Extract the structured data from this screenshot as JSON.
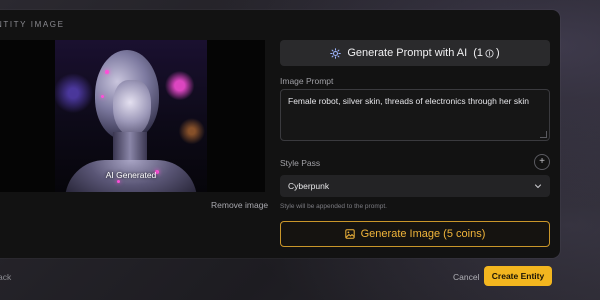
{
  "modal": {
    "section_title": "NTITY IMAGE"
  },
  "image": {
    "overlay_label": "AI Generated",
    "remove_label": "Remove image"
  },
  "form": {
    "generate_prompt_label": "Generate Prompt with AI",
    "generate_prompt_cost": "(1",
    "generate_prompt_cost_close": ")",
    "prompt_label": "Image Prompt",
    "prompt_value": "Female robot, silver skin, threads of electronics through her skin",
    "style_label": "Style Pass",
    "style_add_icon": "plus-icon",
    "style_value": "Cyberpunk",
    "style_hint": "Style will be appended to the prompt.",
    "generate_image_label": "Generate Image (5 coins)"
  },
  "footer": {
    "back_label": "ack",
    "cancel_label": "Cancel",
    "create_label": "Create Entity"
  },
  "colors": {
    "accent": "#f3b61f",
    "modal_bg": "#121212"
  }
}
